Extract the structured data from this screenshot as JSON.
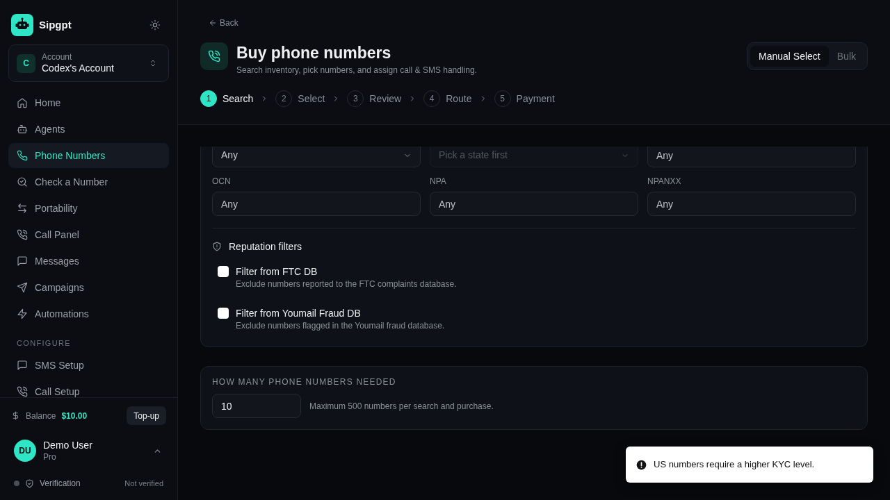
{
  "sidebar": {
    "brand": "Sipgpt",
    "account": {
      "initial": "C",
      "label": "Account",
      "name": "Codex's Account"
    },
    "nav_groups": [
      {
        "items": [
          {
            "label": "Home",
            "selected": false
          },
          {
            "label": "Agents",
            "selected": false
          },
          {
            "label": "Phone Numbers",
            "selected": true
          },
          {
            "label": "Check a Number",
            "selected": false
          },
          {
            "label": "Portability",
            "selected": false
          },
          {
            "label": "Call Panel",
            "selected": false
          },
          {
            "label": "Messages",
            "selected": false
          },
          {
            "label": "Campaigns",
            "selected": false
          },
          {
            "label": "Automations",
            "selected": false
          }
        ]
      },
      {
        "title": "CONFIGURE",
        "items": [
          {
            "label": "SMS Setup",
            "selected": false
          },
          {
            "label": "Call Setup",
            "selected": false
          }
        ]
      }
    ],
    "balance": {
      "label": "Balance",
      "amount": "$10.00",
      "button": "Top-up"
    },
    "user": {
      "initials": "DU",
      "name": "Demo User",
      "plan": "Pro"
    },
    "verification": {
      "label": "Verification",
      "status": "Not verified",
      "verified": false
    }
  },
  "header": {
    "back": "Back",
    "title": "Buy phone numbers",
    "subtitle": "Search inventory, pick numbers, and assign call & SMS handling.",
    "modes": [
      {
        "label": "Manual Select",
        "selected": true
      },
      {
        "label": "Bulk",
        "selected": false
      }
    ],
    "steps": [
      {
        "number": "1",
        "label": "Search",
        "selected": true
      },
      {
        "number": "2",
        "label": "Select",
        "selected": false
      },
      {
        "number": "3",
        "label": "Review",
        "selected": false
      },
      {
        "number": "4",
        "label": "Route",
        "selected": false
      },
      {
        "number": "5",
        "label": "Payment",
        "selected": false
      }
    ]
  },
  "filters": {
    "rows": [
      {
        "fields": [
          {
            "kind": "select",
            "value": "Any",
            "disabled": false
          },
          {
            "kind": "select",
            "placeholder": "Pick a state first",
            "disabled": true
          },
          {
            "kind": "input",
            "placeholder": "Any"
          }
        ]
      },
      {
        "fields": [
          {
            "kind": "input",
            "label": "OCN",
            "placeholder": "Any"
          },
          {
            "kind": "input",
            "label": "NPA",
            "placeholder": "Any"
          },
          {
            "kind": "input",
            "label": "NPANXX",
            "placeholder": "Any"
          }
        ]
      }
    ],
    "reputation": {
      "title": "Reputation filters",
      "options": [
        {
          "title": "Filter from FTC DB",
          "description": "Exclude numbers reported to the FTC complaints database.",
          "checked": false
        },
        {
          "title": "Filter from Youmail Fraud DB",
          "description": "Exclude numbers flagged in the Youmail fraud database.",
          "checked": false
        }
      ]
    }
  },
  "quantity": {
    "label": "HOW MANY PHONE NUMBERS NEEDED",
    "value": "10",
    "hint": "Maximum 500 numbers per search and purchase."
  },
  "toast": {
    "message": "US numbers require a higher KYC level."
  }
}
